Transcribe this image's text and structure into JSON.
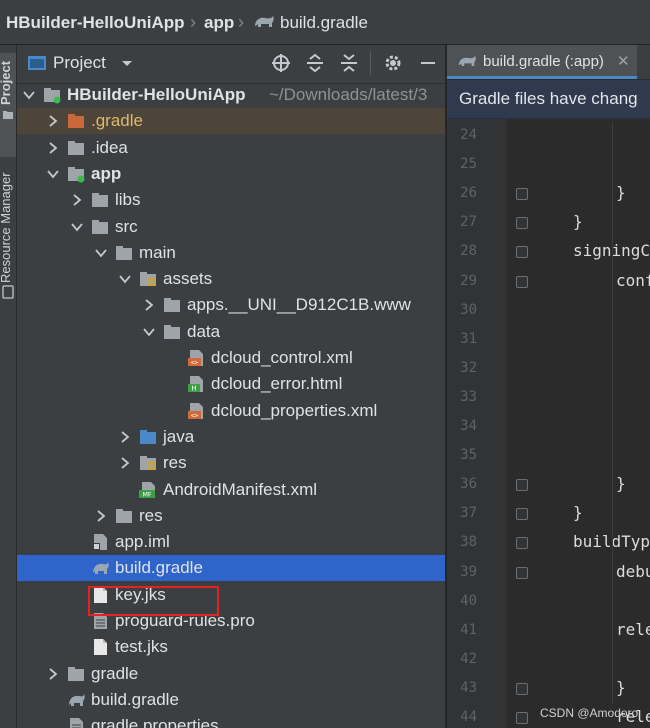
{
  "breadcrumb": {
    "project": "HBuilder-HelloUniApp",
    "module": "app",
    "file": "build.gradle"
  },
  "left_strip": {
    "project_tab": "Project",
    "resource_manager_tab": "Resource Manager"
  },
  "panel": {
    "title": "Project",
    "icons": [
      "locate-icon",
      "expand-all-icon",
      "collapse-all-icon",
      "gear-icon",
      "minimize-icon"
    ]
  },
  "tree": [
    {
      "label": "HBuilder-HelloUniApp",
      "suffix": "~/Downloads/latest/3",
      "depth": 0,
      "chev": "down",
      "icon": "folder-module",
      "bold": true
    },
    {
      "label": ".gradle",
      "depth": 1,
      "chev": "right",
      "icon": "folder-orange",
      "highlight": true
    },
    {
      "label": ".idea",
      "depth": 1,
      "chev": "right",
      "icon": "folder"
    },
    {
      "label": "app",
      "depth": 1,
      "chev": "down",
      "icon": "folder-module",
      "bold": true
    },
    {
      "label": "libs",
      "depth": 2,
      "chev": "right",
      "icon": "folder"
    },
    {
      "label": "src",
      "depth": 2,
      "chev": "down",
      "icon": "folder"
    },
    {
      "label": "main",
      "depth": 3,
      "chev": "down",
      "icon": "folder"
    },
    {
      "label": "assets",
      "depth": 4,
      "chev": "down",
      "icon": "folder-resource"
    },
    {
      "label": "apps.__UNI__D912C1B.www",
      "depth": 5,
      "chev": "right",
      "icon": "folder"
    },
    {
      "label": "data",
      "depth": 5,
      "chev": "down",
      "icon": "folder"
    },
    {
      "label": "dcloud_control.xml",
      "depth": 6,
      "chev": "none",
      "icon": "file-xml"
    },
    {
      "label": "dcloud_error.html",
      "depth": 6,
      "chev": "none",
      "icon": "file-html"
    },
    {
      "label": "dcloud_properties.xml",
      "depth": 6,
      "chev": "none",
      "icon": "file-xml"
    },
    {
      "label": "java",
      "depth": 4,
      "chev": "right",
      "icon": "folder-blue"
    },
    {
      "label": "res",
      "depth": 4,
      "chev": "right",
      "icon": "folder-resource"
    },
    {
      "label": "AndroidManifest.xml",
      "depth": 4,
      "chev": "none",
      "icon": "file-manifest"
    },
    {
      "label": "res",
      "depth": 3,
      "chev": "right",
      "icon": "folder"
    },
    {
      "label": "app.iml",
      "depth": 2,
      "chev": "none",
      "icon": "file-iml"
    },
    {
      "label": "build.gradle",
      "depth": 2,
      "chev": "none",
      "icon": "gradle",
      "selected": true
    },
    {
      "label": "key.jks",
      "depth": 2,
      "chev": "none",
      "icon": "file",
      "boxed": true
    },
    {
      "label": "proguard-rules.pro",
      "depth": 2,
      "chev": "none",
      "icon": "file-text"
    },
    {
      "label": "test.jks",
      "depth": 2,
      "chev": "none",
      "icon": "file"
    },
    {
      "label": "gradle",
      "depth": 1,
      "chev": "right",
      "icon": "folder"
    },
    {
      "label": "build.gradle",
      "depth": 1,
      "chev": "none",
      "icon": "gradle"
    },
    {
      "label": "gradle.properties",
      "depth": 1,
      "chev": "none",
      "icon": "file-text"
    }
  ],
  "editor": {
    "tab_label": "build.gradle (:app)",
    "banner": "Gradle files have chang",
    "line_numbers": [
      "24",
      "25",
      "26",
      "27",
      "28",
      "29",
      "30",
      "31",
      "32",
      "33",
      "34",
      "35",
      "36",
      "37",
      "38",
      "39",
      "40",
      "41",
      "42",
      "43",
      "44"
    ],
    "code_lines": [
      {
        "line": "26",
        "text": "}",
        "indent": 2
      },
      {
        "line": "27",
        "text": "}",
        "indent": 1
      },
      {
        "line": "28",
        "text": "signingC",
        "indent": 1
      },
      {
        "line": "29",
        "text": "conf",
        "indent": 2
      },
      {
        "line": "36",
        "text": "}",
        "indent": 2
      },
      {
        "line": "37",
        "text": "}",
        "indent": 1
      },
      {
        "line": "38",
        "text": "buildTyp",
        "indent": 1
      },
      {
        "line": "39",
        "text": "debu",
        "indent": 2
      },
      {
        "line": "41",
        "text": "rele",
        "indent": 3
      },
      {
        "line": "43",
        "text": "}",
        "indent": 2
      },
      {
        "line": "44",
        "text": "rele",
        "indent": 3
      }
    ]
  },
  "watermark": "CSDN @Amodoro"
}
